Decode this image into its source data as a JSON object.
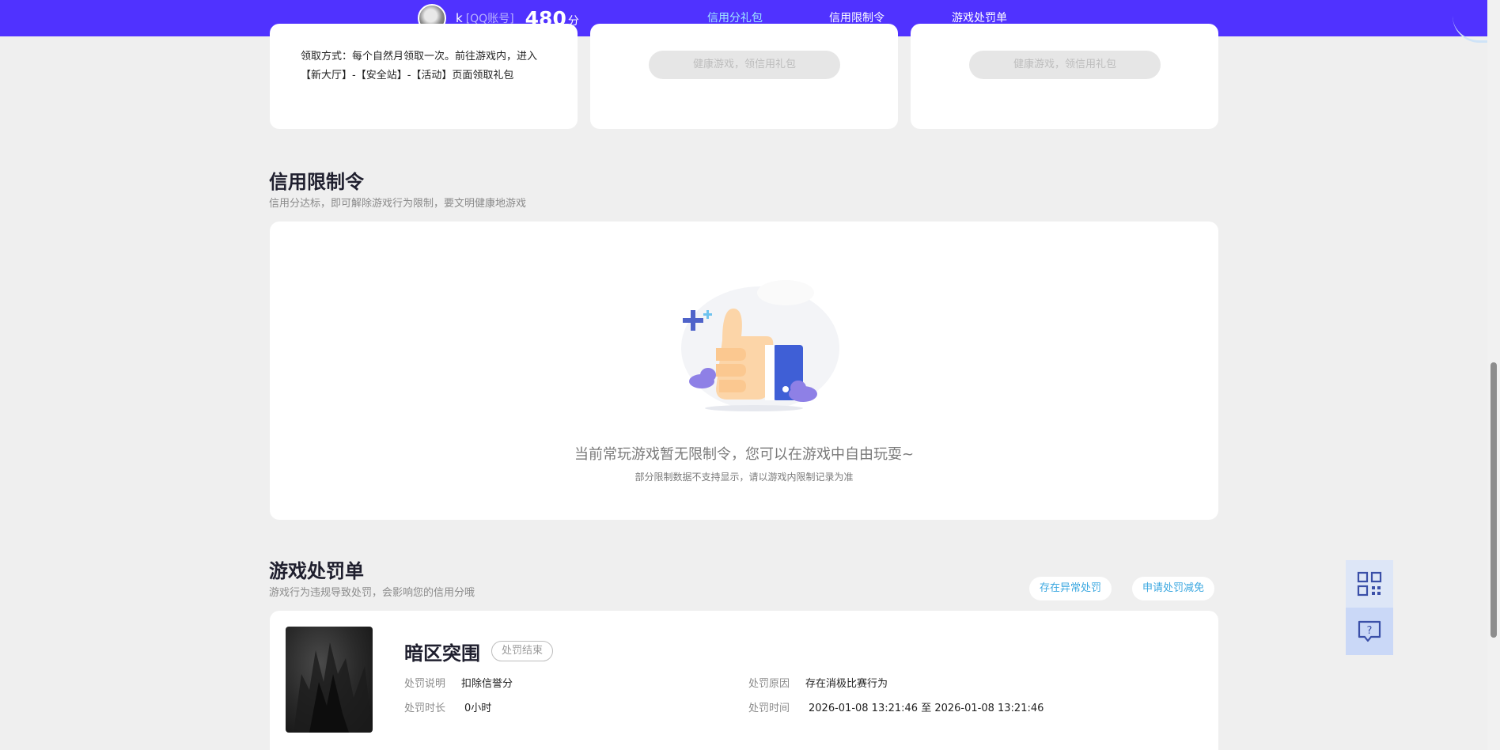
{
  "header": {
    "username": "k",
    "account_type": "[QQ账号]",
    "score": "480",
    "score_unit": "分",
    "nav": [
      {
        "label": "信用分礼包",
        "active": true
      },
      {
        "label": "信用限制令",
        "active": false
      },
      {
        "label": "游戏处罚单",
        "active": false
      }
    ]
  },
  "gift_section": {
    "claim_method": "领取方式：每个自然月领取一次。前往游戏内，进入【新大厅】-【安全站】-【活动】页面领取礼包",
    "disabled_button_1": "健康游戏，领信用礼包",
    "disabled_button_2": "健康游戏，领信用礼包"
  },
  "restriction_section": {
    "title": "信用限制令",
    "subtitle": "信用分达标，即可解除游戏行为限制，要文明健康地游戏",
    "empty_message": "当前常玩游戏暂无限制令，您可以在游戏中自由玩耍~",
    "empty_note": "部分限制数据不支持显示，请以游戏内限制记录为准"
  },
  "penalty_section": {
    "title": "游戏处罚单",
    "subtitle": "游戏行为违规导致处罚，会影响您的信用分哦",
    "link_abnormal": "存在异常处罚",
    "link_appeal": "申请处罚减免",
    "record": {
      "game_name": "暗区突围",
      "status": "处罚结束",
      "desc_label": "处罚说明",
      "desc_value": "扣除信誉分",
      "duration_label": "处罚时长",
      "duration_value": "0小时",
      "reason_label": "处罚原因",
      "reason_value": "存在消极比赛行为",
      "time_label": "处罚时间",
      "time_value": "2026-01-08 13:21:46 至 2026-01-08 13:21:46"
    }
  },
  "colors": {
    "topbar": "#5032ff",
    "active_nav": "#9fe7ff",
    "link": "#3aa7e0"
  }
}
